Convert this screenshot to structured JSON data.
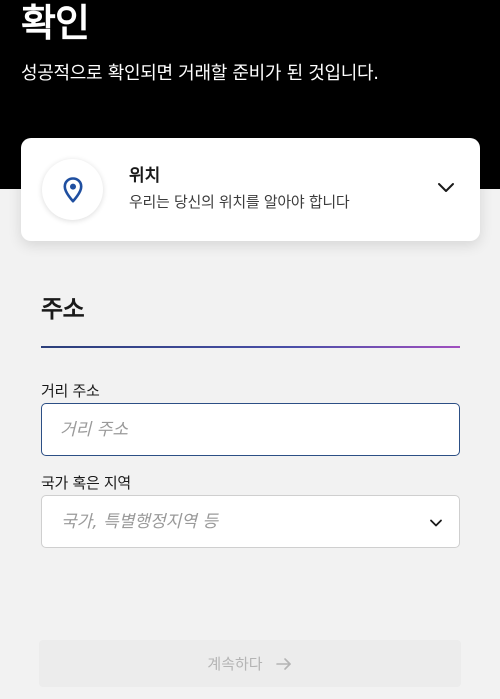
{
  "header": {
    "title": "확인",
    "subtitle": "성공적으로 확인되면 거래할 준비가 된 것입니다."
  },
  "location_card": {
    "icon": "location-pin-icon",
    "title": "위치",
    "description": "우리는 당신의 위치를 알아야 합니다",
    "expand_icon": "chevron-down-icon"
  },
  "address": {
    "section_title": "주소",
    "street": {
      "label": "거리 주소",
      "placeholder": "거리 주소",
      "value": ""
    },
    "country": {
      "label": "국가 혹은 지역",
      "placeholder": "국가, 특별행정지역 등",
      "selected": ""
    }
  },
  "footer": {
    "continue_label": "계속하다",
    "continue_icon": "arrow-right-icon",
    "continue_enabled": false
  },
  "colors": {
    "header_bg": "#000000",
    "accent_blue": "#1f4fa0",
    "input_border": "#2c4f85",
    "page_bg": "#f2f2f2"
  }
}
